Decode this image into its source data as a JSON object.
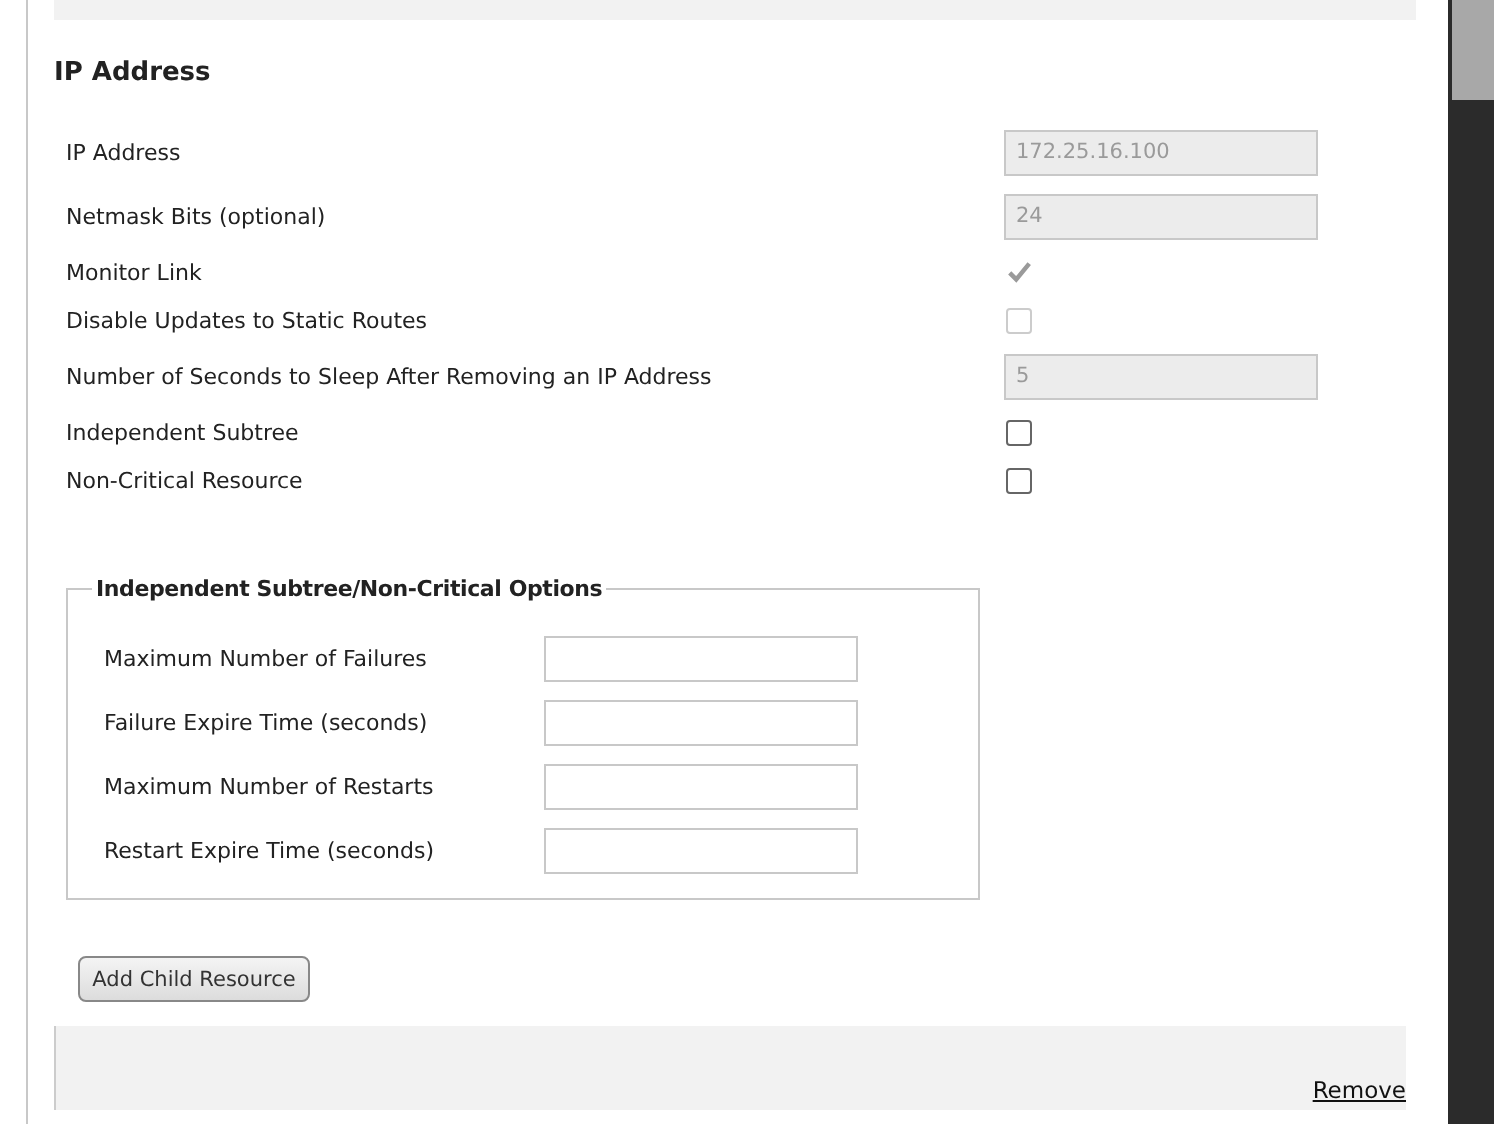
{
  "section": {
    "title": "IP Address"
  },
  "fields": [
    {
      "kind": "text",
      "label": "IP Address",
      "value": "172.25.16.100",
      "disabled": true
    },
    {
      "kind": "text",
      "label": "Netmask Bits (optional)",
      "value": "24",
      "disabled": true
    },
    {
      "kind": "checkbox",
      "label": "Monitor Link",
      "checked": true,
      "disabled": true
    },
    {
      "kind": "checkbox",
      "label": "Disable Updates to Static Routes",
      "checked": false,
      "disabled": true
    },
    {
      "kind": "text",
      "label": "Number of Seconds to Sleep After Removing an IP Address",
      "value": "5",
      "disabled": true
    },
    {
      "kind": "checkbox",
      "label": "Independent Subtree",
      "checked": false,
      "disabled": false
    },
    {
      "kind": "checkbox",
      "label": "Non-Critical Resource",
      "checked": false,
      "disabled": false
    }
  ],
  "options": {
    "legend": "Independent Subtree/Non-Critical Options",
    "fields": [
      {
        "label": "Maximum Number of Failures"
      },
      {
        "label": "Failure Expire Time (seconds)"
      },
      {
        "label": "Maximum Number of Restarts"
      },
      {
        "label": "Restart Expire Time (seconds)"
      }
    ]
  },
  "add_button": "Add Child Resource",
  "remove_link": "Remove"
}
